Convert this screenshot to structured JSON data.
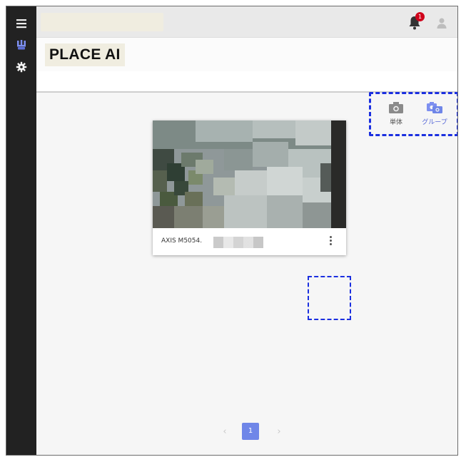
{
  "app": {
    "title": "PLACE AI",
    "search_value": ""
  },
  "sidebar": {
    "items": [
      {
        "icon": "menu-icon"
      },
      {
        "icon": "camera-network-icon"
      },
      {
        "icon": "gear-icon"
      }
    ]
  },
  "header": {
    "notification_count": "1",
    "notification_icon": "bell-icon",
    "user_icon": "user-icon"
  },
  "view_toggle": {
    "single_label": "単体",
    "group_label": "グループ"
  },
  "cameras": [
    {
      "name": "AXIS M5054."
    }
  ],
  "pagination": {
    "prev": "‹",
    "current": "1",
    "next": "›"
  },
  "colors": {
    "rail": "#222222",
    "accent": "#6f86e8",
    "badge": "#d0021b",
    "dashed_highlight": "#1b2fe0"
  }
}
